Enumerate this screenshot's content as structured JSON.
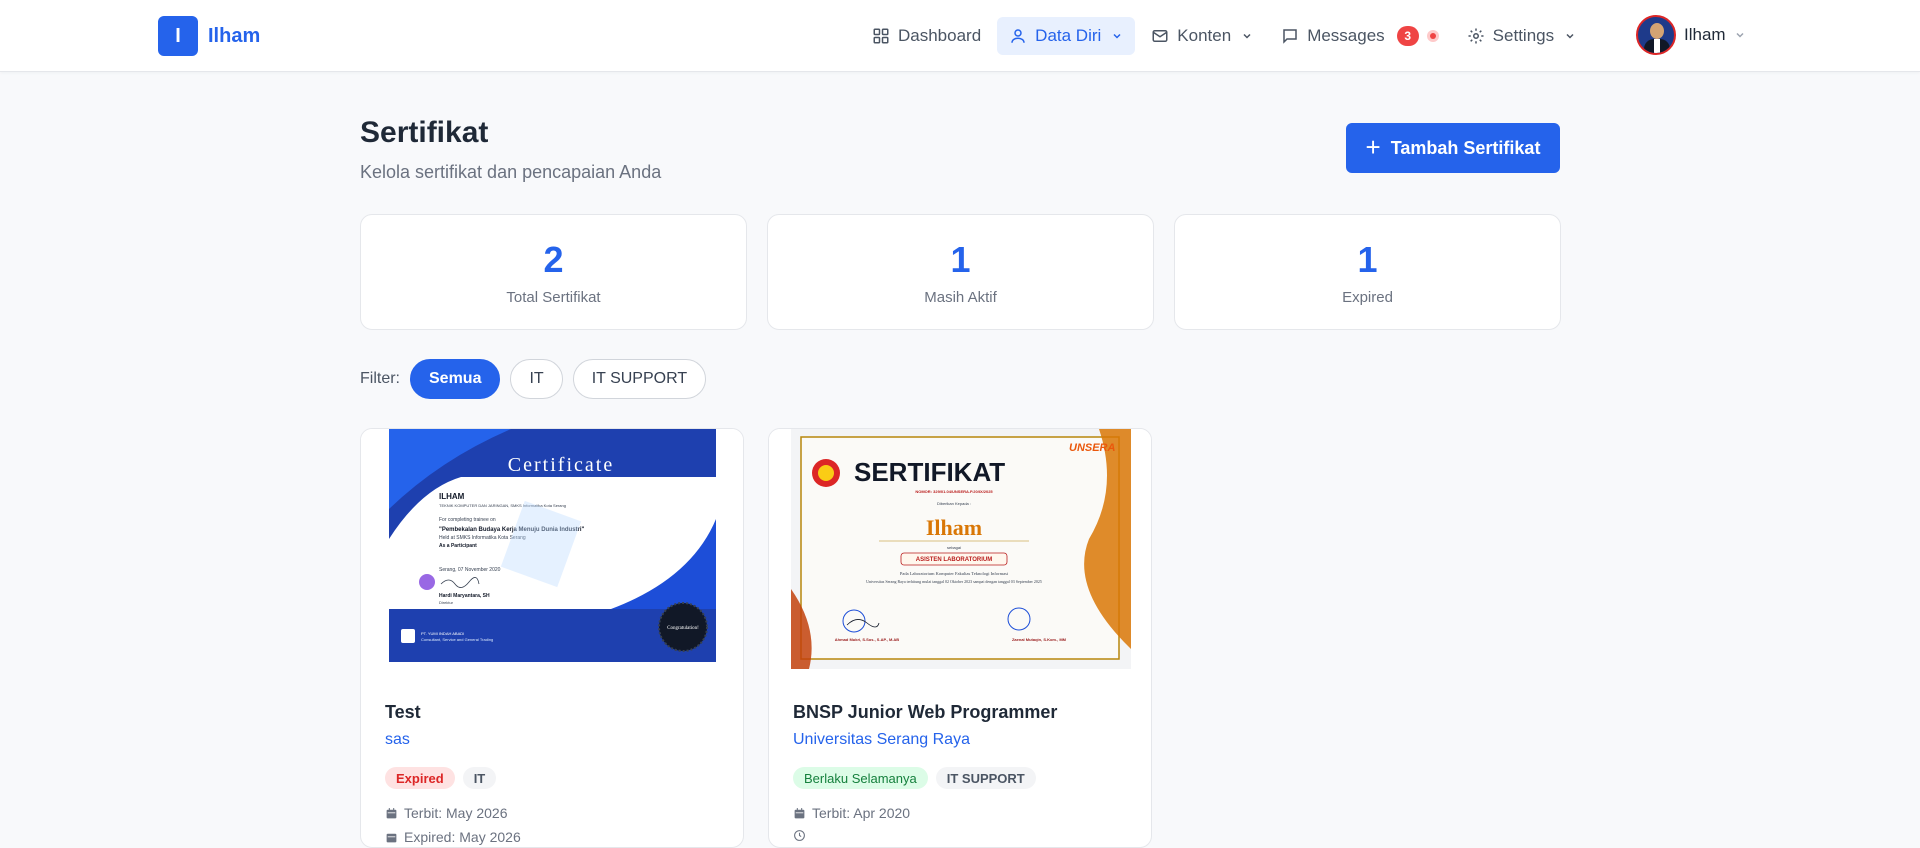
{
  "brand": {
    "logo_letter": "I",
    "name": "Ilham"
  },
  "nav": {
    "dashboard": "Dashboard",
    "data_diri": "Data Diri",
    "konten": "Konten",
    "messages": "Messages",
    "messages_count": "3",
    "settings": "Settings"
  },
  "user": {
    "name": "Ilham"
  },
  "header": {
    "title": "Sertifikat",
    "subtitle": "Kelola sertifikat dan pencapaian Anda",
    "add_button": "Tambah Sertifikat"
  },
  "stats": [
    {
      "value": "2",
      "label": "Total Sertifikat"
    },
    {
      "value": "1",
      "label": "Masih Aktif"
    },
    {
      "value": "1",
      "label": "Expired"
    }
  ],
  "filter": {
    "label": "Filter:",
    "options": [
      "Semua",
      "IT",
      "IT SUPPORT"
    ],
    "selected": "Semua"
  },
  "certificates": [
    {
      "title": "Test",
      "issuer": "sas",
      "status": "Expired",
      "category": "IT",
      "issued": "Terbit: May 2026",
      "expired": "Expired: May 2026",
      "image": {
        "heading": "Certificate",
        "name": "ILHAM",
        "line1": "TEKNIK KOMPUTER DAN JARINGAN, SMKS Informatika Kota Serang",
        "line2": "For completing trainee on",
        "line3": "\"Pembekalan Budaya Kerja Menuju Dunia Industri\"",
        "line4": "Held at SMKS Informatika Kota Serang",
        "line5": "As a Participant",
        "date": "Serang, 07 November 2020",
        "signer": "Hardi Maryantara, SH",
        "signer_role": "Direktur",
        "company": "PT. YUMI INDAH ABADI",
        "company_sub": "Consultant, Service and General Trading",
        "seal": "Congratulation!"
      }
    },
    {
      "title": "BNSP Junior Web Programmer",
      "issuer": "Universitas Serang Raya",
      "status": "Berlaku Selamanya",
      "category": "IT SUPPORT",
      "issued": "Terbit: Apr 2020",
      "image": {
        "heading": "SERTIFIKAT",
        "brand": "UNSERA",
        "number": "NOMOR: 329/01.04/UNSERA.P.20/IX/2025",
        "given": "Diberikan Kepada :",
        "name": "Ilham",
        "as": "sebagai",
        "role": "ASISTEN LABORATORIUM",
        "line1": "Pada Laboratorium Komputer Fakultas Teknologi Informasi",
        "line2": "Universitas Serang Raya terhitung mulai tanggal 02 Oktober 2023 sampai dengan tanggal 03 September 2025",
        "signer1": "Ahmad Mukri, S.Sos., S.AP., M.AB",
        "signer2": "Zaenal Mutaqin, S.Kom., MM"
      }
    }
  ],
  "colors": {
    "primary": "#2563eb",
    "danger": "#dc2626",
    "success": "#15803d",
    "text": "#1f2937",
    "muted": "#6b7280"
  }
}
